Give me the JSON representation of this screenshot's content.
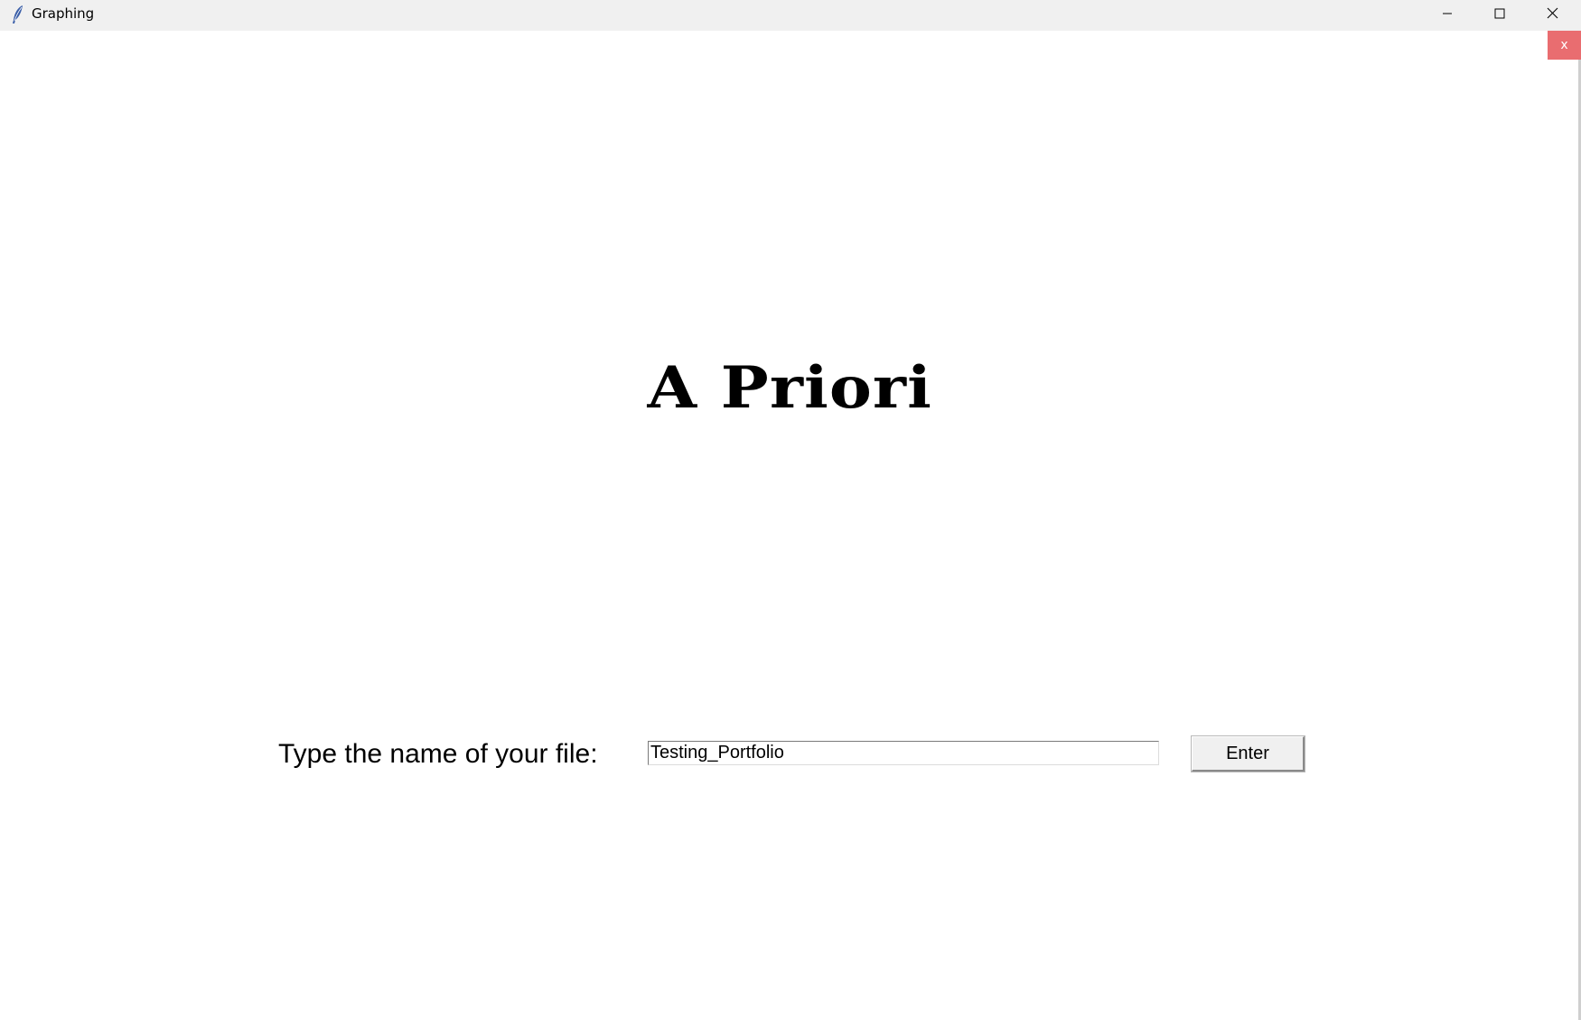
{
  "window": {
    "title": "Graphing",
    "icon": "feather-icon",
    "controls": {
      "minimize_icon": "minimize-icon",
      "maximize_icon": "maximize-icon",
      "close_icon": "close-icon"
    }
  },
  "overlay_close": {
    "label": "x",
    "color": "#e96d70"
  },
  "main": {
    "title": "A Priori",
    "prompt_label": "Type the name of your file:",
    "file_input": {
      "value": "Testing_Portfolio"
    },
    "enter_label": "Enter"
  }
}
